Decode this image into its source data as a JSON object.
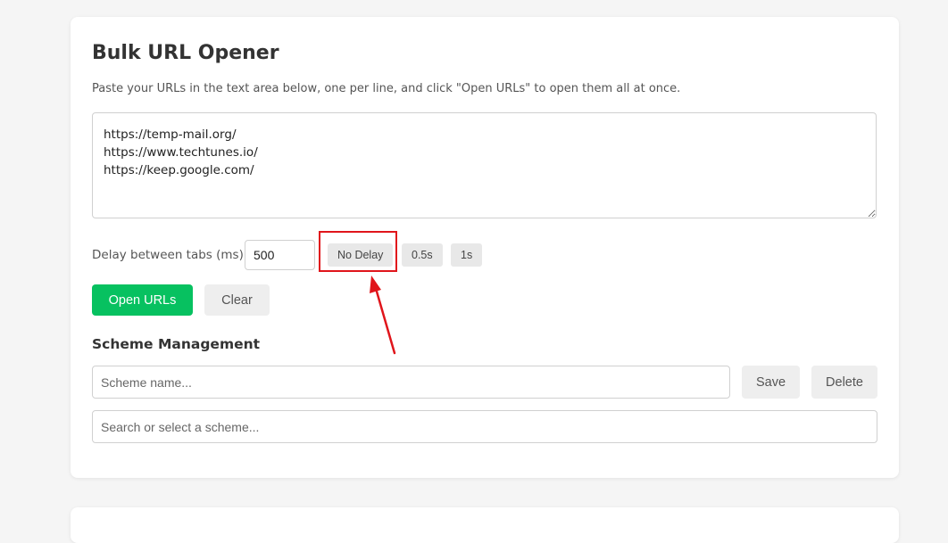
{
  "header": {
    "title": "Bulk URL Opener",
    "description": "Paste your URLs in the text area below, one per line, and click \"Open URLs\" to open them all at once."
  },
  "urls": {
    "value": "https://temp-mail.org/\nhttps://www.techtunes.io/\nhttps://keep.google.com/"
  },
  "delay": {
    "label": "Delay between tabs (ms):",
    "value": "500",
    "presets": [
      "No Delay",
      "0.5s",
      "1s"
    ]
  },
  "actions": {
    "open_label": "Open URLs",
    "clear_label": "Clear"
  },
  "scheme": {
    "section_title": "Scheme Management",
    "name_placeholder": "Scheme name...",
    "save_label": "Save",
    "delete_label": "Delete",
    "search_placeholder": "Search or select a scheme..."
  },
  "colors": {
    "primary": "#07c160",
    "annotation": "#e0151b"
  }
}
